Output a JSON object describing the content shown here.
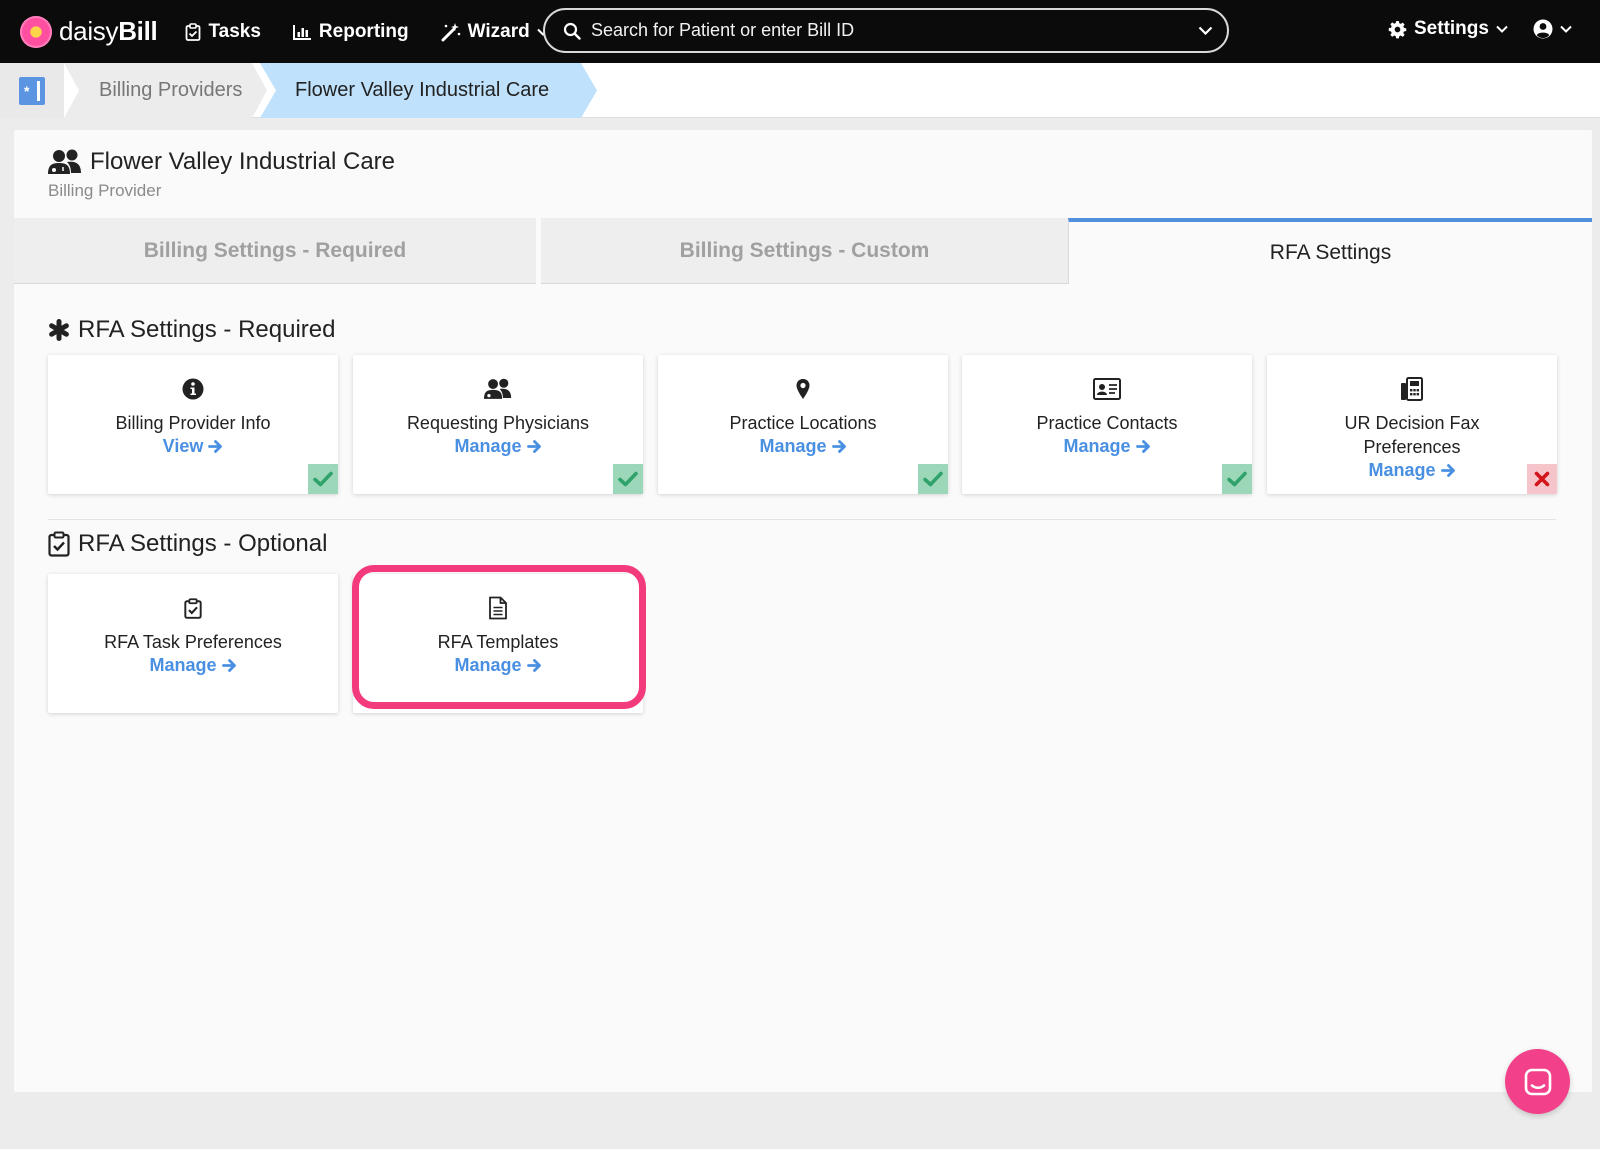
{
  "brand": {
    "name_light": "daisy",
    "name_bold": "Bill",
    "flower_color": "#ff4fa0"
  },
  "nav": {
    "tasks": "Tasks",
    "reporting": "Reporting",
    "wizard": "Wizard",
    "search_placeholder": "Search for Patient or enter Bill ID",
    "settings": "Settings"
  },
  "breadcrumb": {
    "items": [
      "Billing Providers",
      "Flower Valley Industrial Care"
    ],
    "active_color": "#bfe1fb"
  },
  "header": {
    "title": "Flower Valley Industrial Care",
    "subtitle": "Billing Provider"
  },
  "tabs": [
    {
      "label": "Billing Settings - Required",
      "active": false
    },
    {
      "label": "Billing Settings - Custom",
      "active": false
    },
    {
      "label": "RFA Settings",
      "active": true
    }
  ],
  "required": {
    "title": "RFA Settings - Required",
    "cards": [
      {
        "icon": "info-icon",
        "label": "Billing Provider Info",
        "action": "View",
        "status": "complete"
      },
      {
        "icon": "physicians-icon",
        "label": "Requesting Physicians",
        "action": "Manage",
        "status": "complete"
      },
      {
        "icon": "map-pin-icon",
        "label": "Practice Locations",
        "action": "Manage",
        "status": "complete"
      },
      {
        "icon": "contact-card-icon",
        "label": "Practice Contacts",
        "action": "Manage",
        "status": "complete"
      },
      {
        "icon": "fax-icon",
        "label": "UR Decision Fax Preferences",
        "action": "Manage",
        "status": "incomplete"
      }
    ]
  },
  "optional": {
    "title": "RFA Settings - Optional",
    "cards": [
      {
        "icon": "clipboard-check-icon",
        "label": "RFA Task Preferences",
        "action": "Manage"
      },
      {
        "icon": "document-icon",
        "label": "RFA Templates",
        "action": "Manage"
      }
    ]
  },
  "colors": {
    "accent": "#4a90e2",
    "tab_active_border": "#4f8fdd",
    "status_ok": "#9cd7b9",
    "status_ok_check": "#2fa36b",
    "status_bad": "#f6c5cb",
    "status_bad_x": "#d4141c",
    "highlight": "#f23a7c",
    "chat": "#f2418a"
  }
}
